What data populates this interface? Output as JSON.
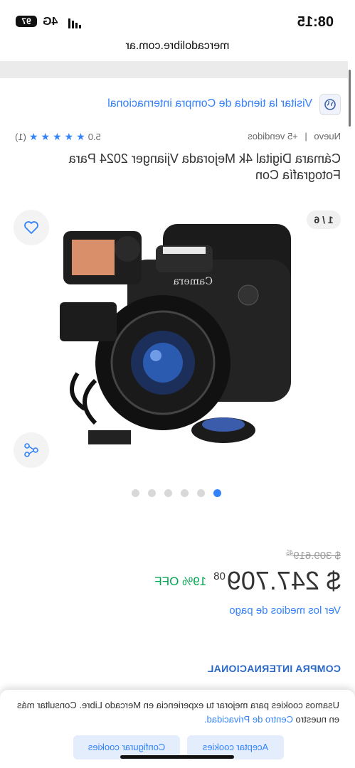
{
  "status_bar": {
    "time": "08:15",
    "network": "4G",
    "battery": "97"
  },
  "browser": {
    "url": "mercadolibre.com.ar"
  },
  "store": {
    "link_label": "Visitar la tienda de Compra internacional"
  },
  "product": {
    "condition": "Nuevo",
    "sold": "+5 vendidos",
    "rating": "5.0",
    "reviews": "(1)",
    "title": "Cámara Digital 4k Mejorada Vjianger 2024 Para Fotografía Con",
    "gallery_counter": "1 / 6",
    "gallery_total": 6,
    "gallery_active": 0,
    "image_text": "Camera"
  },
  "pricing": {
    "old_price": "$ 309.619",
    "old_cents": "45",
    "price": "$ 247.709",
    "cents": "08",
    "discount": "19% OFF",
    "payment_link": "Ver los medios de pago"
  },
  "shipping": {
    "badge": "COMPRA INTERNACIONAL"
  },
  "cookie_banner": {
    "message": "Usamos cookies para mejorar tu experiencia en Mercado Libre. Consultar más en nuestro ",
    "link": "Centro de Privacidad.",
    "accept": "Aceptar cookies",
    "configure": "Configurar cookies"
  },
  "colors": {
    "accent": "#3483fa",
    "discount": "#00a650",
    "intl": "#2968c8"
  }
}
